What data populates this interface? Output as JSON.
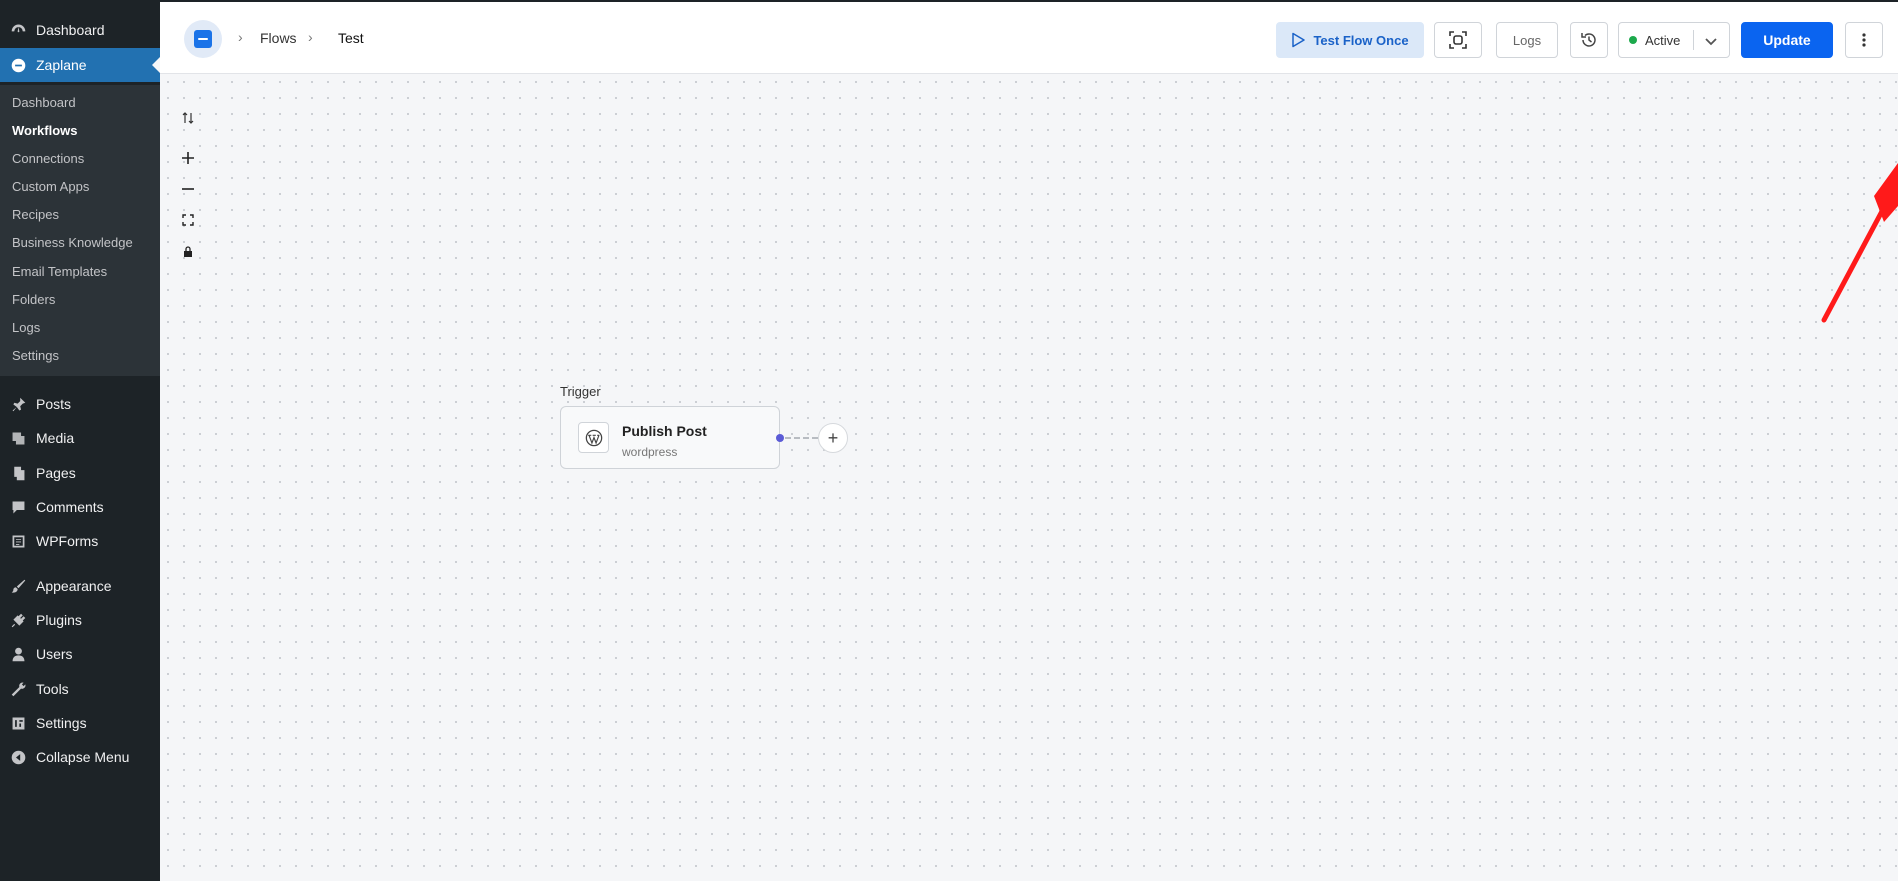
{
  "sidebar": {
    "top_items": [
      {
        "label": "Dashboard",
        "icon": "dashboard-icon"
      },
      {
        "label": "Zaplane",
        "icon": "zaplane-icon"
      }
    ],
    "submenu": [
      "Dashboard",
      "Workflows",
      "Connections",
      "Custom Apps",
      "Recipes",
      "Business Knowledge",
      "Email Templates",
      "Folders",
      "Logs",
      "Settings"
    ],
    "current_submenu": "Workflows",
    "items": [
      {
        "label": "Posts",
        "icon": "pin-icon"
      },
      {
        "label": "Media",
        "icon": "media-icon"
      },
      {
        "label": "Pages",
        "icon": "pages-icon"
      },
      {
        "label": "Comments",
        "icon": "comments-icon"
      },
      {
        "label": "WPForms",
        "icon": "wpforms-icon"
      },
      {
        "label": "Appearance",
        "icon": "brush-icon"
      },
      {
        "label": "Plugins",
        "icon": "plugin-icon"
      },
      {
        "label": "Users",
        "icon": "user-icon"
      },
      {
        "label": "Tools",
        "icon": "wrench-icon"
      },
      {
        "label": "Settings",
        "icon": "settings-icon"
      },
      {
        "label": "Collapse Menu",
        "icon": "collapse-icon"
      }
    ]
  },
  "header": {
    "breadcrumb": [
      "Flows",
      "Test"
    ],
    "test_flow_label": "Test Flow Once",
    "logs_label": "Logs",
    "status_label": "Active",
    "status_color": "#1ca94c",
    "update_label": "Update",
    "accent": "#0a64f0"
  },
  "canvas": {
    "trigger_label": "Trigger",
    "node": {
      "title": "Publish Post",
      "subtitle": "wordpress",
      "icon": "wordpress-icon"
    },
    "add_label": "+"
  }
}
